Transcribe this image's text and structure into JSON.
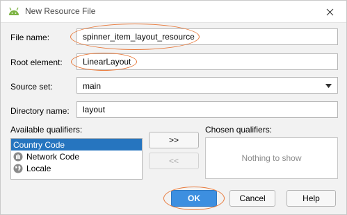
{
  "window": {
    "title": "New Resource File",
    "app_icon": "android-icon",
    "close_icon": "close-icon"
  },
  "form": {
    "file_name": {
      "label": "File name:",
      "value": "spinner_item_layout_resource"
    },
    "root_element": {
      "label": "Root element:",
      "value": "LinearLayout"
    },
    "source_set": {
      "label": "Source set:",
      "value": "main"
    },
    "directory_name": {
      "label": "Directory name:",
      "value": "layout"
    }
  },
  "qualifiers": {
    "available_label": "Available qualifiers:",
    "chosen_label": "Chosen qualifiers:",
    "available": [
      {
        "label": "Country Code",
        "icon": "globe-icon",
        "selected": true
      },
      {
        "label": "Network Code",
        "icon": "network-icon",
        "selected": false
      },
      {
        "label": "Locale",
        "icon": "globe-icon",
        "selected": false
      }
    ],
    "add_button": ">>",
    "remove_button": "<<",
    "empty_text": "Nothing to show"
  },
  "buttons": {
    "ok": "OK",
    "cancel": "Cancel",
    "help": "Help"
  },
  "colors": {
    "accent": "#3d8fe0",
    "selection": "#2675bf",
    "highlight": "#e8793a",
    "android_green": "#7cb342"
  }
}
